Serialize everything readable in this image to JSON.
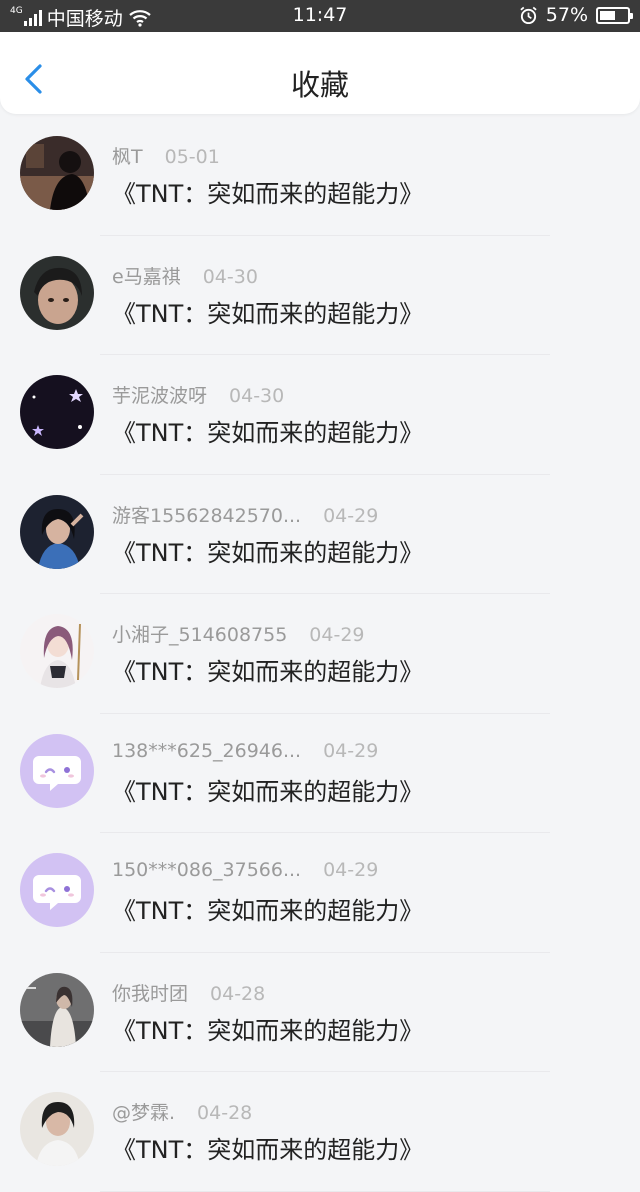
{
  "status_bar": {
    "network": "4G",
    "carrier": "中国移动",
    "time": "11:47",
    "battery_percent": "57%",
    "battery_level": 0.57
  },
  "header": {
    "title": "收藏",
    "back_icon": "chevron-left-icon",
    "accent_color": "#2a8ee8"
  },
  "items": [
    {
      "user": "枫T",
      "date": "05-01",
      "title": "《TNT：突如而来的超能力》",
      "avatar": "photo-dark"
    },
    {
      "user": "e马嘉祺",
      "date": "04-30",
      "title": "《TNT：突如而来的超能力》",
      "avatar": "photo-face"
    },
    {
      "user": "芋泥波波呀",
      "date": "04-30",
      "title": "《TNT：突如而来的超能力》",
      "avatar": "moon-stars"
    },
    {
      "user": "游客15562842570...",
      "date": "04-29",
      "title": "《TNT：突如而来的超能力》",
      "avatar": "photo-girl"
    },
    {
      "user": "小湘子_514608755",
      "date": "04-29",
      "title": "《TNT：突如而来的超能力》",
      "avatar": "anime-girl"
    },
    {
      "user": "138***625_26946...",
      "date": "04-29",
      "title": "《TNT：突如而来的超能力》",
      "avatar": "default-chat"
    },
    {
      "user": "150***086_37566...",
      "date": "04-29",
      "title": "《TNT：突如而来的超能力》",
      "avatar": "default-chat"
    },
    {
      "user": "你我时团",
      "date": "04-28",
      "title": "《TNT：突如而来的超能力》",
      "avatar": "photo-street"
    },
    {
      "user": "@梦霖.",
      "date": "04-28",
      "title": "《TNT：突如而来的超能力》",
      "avatar": "photo-person"
    }
  ]
}
